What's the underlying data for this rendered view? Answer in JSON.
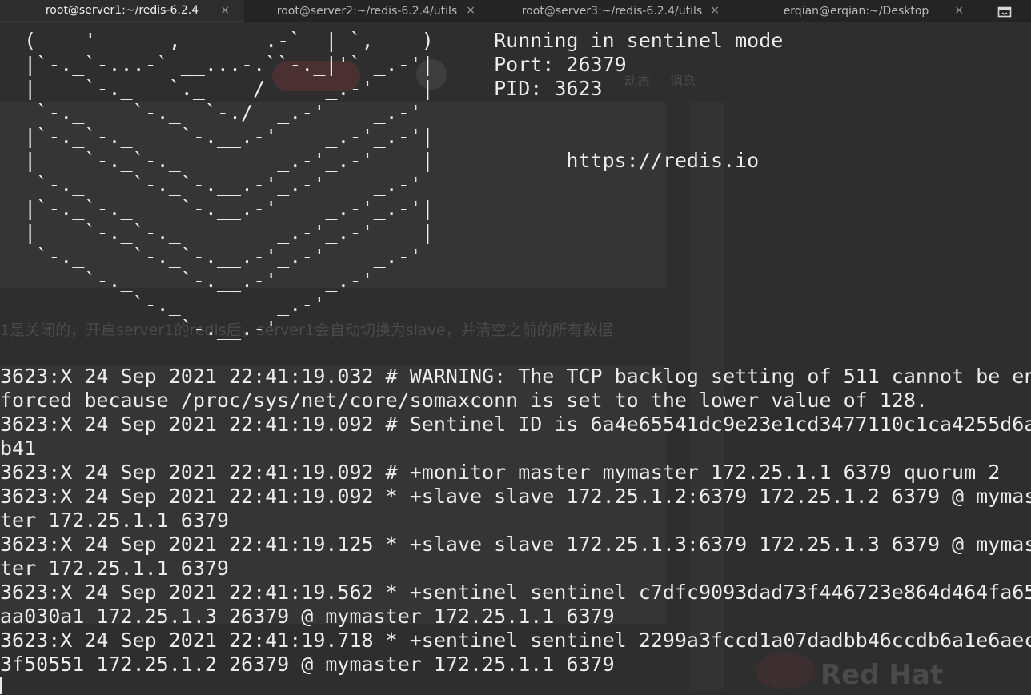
{
  "tabs": [
    {
      "label": "root@server1:~/redis-6.2.4",
      "active": true
    },
    {
      "label": "root@server2:~/redis-6.2.4/utils",
      "active": false
    },
    {
      "label": "root@server3:~/redis-6.2.4/utils",
      "active": false
    },
    {
      "label": "erqian@erqian:~/Desktop",
      "active": false
    }
  ],
  "tab_close_glyph": "×",
  "new_tab_icon": "new-tab-icon",
  "terminal": {
    "lines": [
      "  (    '      ,       .-`  | `,    )     Running in sentinel mode",
      "  |`-._`-...-` __...-.``-._|'` _.-'|     Port: 26379",
      "  |    `-._   `._    /     _.-'    |     PID: 3623",
      "   `-._    `-._  `-./  _.-'    _.-'",
      "  |`-._`-._    `-.__.-'    _.-'_.-'|",
      "  |    `-._`-._        _.-'_.-'    |           https://redis.io",
      "   `-._    `-._`-.__.-'_.-'    _.-'",
      "  |`-._`-._    `-.__.-'    _.-'_.-'|",
      "  |    `-._`-._        _.-'_.-'    |",
      "   `-._    `-._`-.__.-'_.-'    _.-'",
      "       `-._    `-.__.-'    _.-'",
      "           `-._        _.-'",
      "               `-.__.-'",
      "",
      "3623:X 24 Sep 2021 22:41:19.032 # WARNING: The TCP backlog setting of 511 cannot be en",
      "forced because /proc/sys/net/core/somaxconn is set to the lower value of 128.",
      "3623:X 24 Sep 2021 22:41:19.092 # Sentinel ID is 6a4e65541dc9e23e1cd3477110c1ca4255d6a",
      "b41",
      "3623:X 24 Sep 2021 22:41:19.092 # +monitor master mymaster 172.25.1.1 6379 quorum 2",
      "3623:X 24 Sep 2021 22:41:19.092 * +slave slave 172.25.1.2:6379 172.25.1.2 6379 @ mymas",
      "ter 172.25.1.1 6379",
      "3623:X 24 Sep 2021 22:41:19.125 * +slave slave 172.25.1.3:6379 172.25.1.3 6379 @ mymas",
      "ter 172.25.1.1 6379",
      "3623:X 24 Sep 2021 22:41:19.562 * +sentinel sentinel c7dfc9093dad73f446723e864d464fa65",
      "aa030a1 172.25.1.3 26379 @ mymaster 172.25.1.1 6379",
      "3623:X 24 Sep 2021 22:41:19.718 * +sentinel sentinel 2299a3fccd1a07dadbb46ccdb6a1e6aec",
      "3f50551 172.25.1.2 26379 @ mymaster 172.25.1.1 6379"
    ]
  },
  "background_page": {
    "nav_text": "动态 消息",
    "body_text": "1是关闭的，开启server1的redis后，server1会自动切换为slave，并清空之前的所有数据",
    "logo_text": "Red Hat"
  }
}
